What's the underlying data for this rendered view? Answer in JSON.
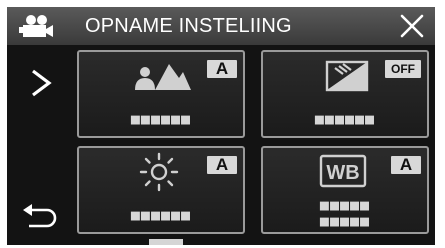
{
  "header": {
    "mode_icon": "video-camera-icon",
    "title": "OPNAME INSTELIING",
    "close_icon": "close-icon"
  },
  "nav": {
    "next_icon": "chevron-right-icon",
    "back_icon": "return-arrow-icon"
  },
  "tiles": [
    {
      "icon": "scene-select-icon",
      "badge": "A",
      "value": "■■■■■■"
    },
    {
      "icon": "backlight-compensation-icon",
      "badge": "OFF",
      "value": "■■■■■■"
    },
    {
      "icon": "brightness-sun-icon",
      "badge": "A",
      "value": "■■■■■■"
    },
    {
      "icon": "white-balance-icon",
      "badge": "A",
      "value": "■■■■■",
      "value2": "■■■■■"
    }
  ],
  "colors": {
    "screen_bg": "#131313",
    "header_bg": "#4a4a4a",
    "tile_border": "#9a9a9a",
    "badge_bg": "#d8d8d8",
    "text": "#ffffff"
  }
}
